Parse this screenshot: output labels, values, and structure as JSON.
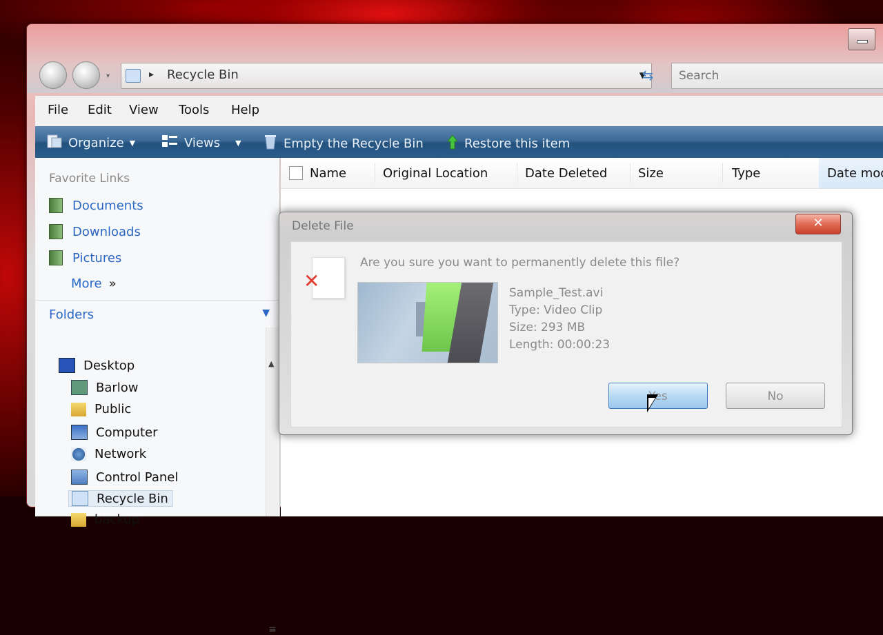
{
  "window": {
    "address": "Recycle Bin",
    "search_placeholder": "Search"
  },
  "menu": [
    "File",
    "Edit",
    "View",
    "Tools",
    "Help"
  ],
  "toolbar": {
    "organize": "Organize",
    "views": "Views",
    "empty": "Empty the Recycle Bin",
    "restore": "Restore this item"
  },
  "nav": {
    "favorites_title": "Favorite Links",
    "favorites": [
      "Documents",
      "Downloads",
      "Pictures"
    ],
    "more": "More",
    "folders_title": "Folders",
    "tree": [
      "Desktop",
      "Barlow",
      "Public",
      "Computer",
      "Network",
      "Control Panel",
      "Recycle Bin",
      "backup"
    ]
  },
  "columns": [
    "Name",
    "Original Location",
    "Date Deleted",
    "Size",
    "Type",
    "Date mod"
  ],
  "dialog": {
    "title": "Delete File",
    "close": "✕",
    "question": "Are you sure you want to permanently delete this file?",
    "file_name": "Sample_Test.avi",
    "file_type": "Type: Video Clip",
    "file_size": "Size: 293 MB",
    "file_length": "Length: 00:00:23",
    "yes": "Yes",
    "no": "No"
  },
  "icons": {
    "back": "back-arrow-icon",
    "forward": "forward-arrow-icon",
    "recycle": "recycle-bin-icon",
    "delete": "red-x-icon"
  }
}
